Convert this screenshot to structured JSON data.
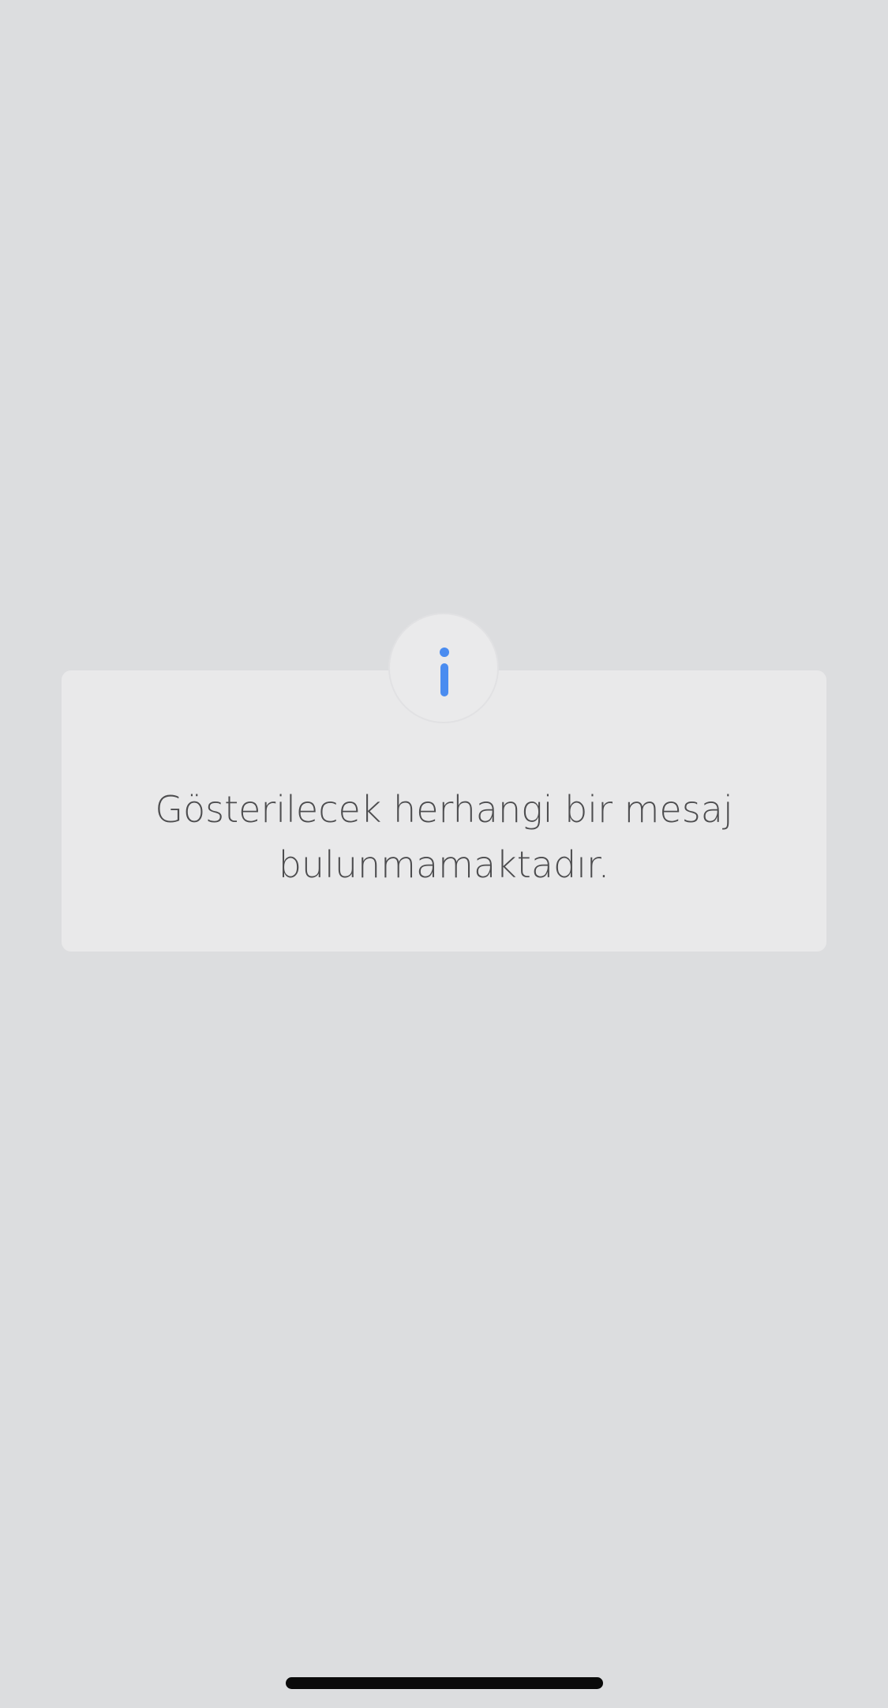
{
  "empty_state": {
    "icon": "info-icon",
    "message": "Gösterilecek herhangi bir mesaj\nbulunmamaktadır."
  },
  "colors": {
    "background": "#dcdddf",
    "card": "#e9e9ea",
    "accent": "#4a8cf0",
    "text": "#4d4d4f"
  }
}
